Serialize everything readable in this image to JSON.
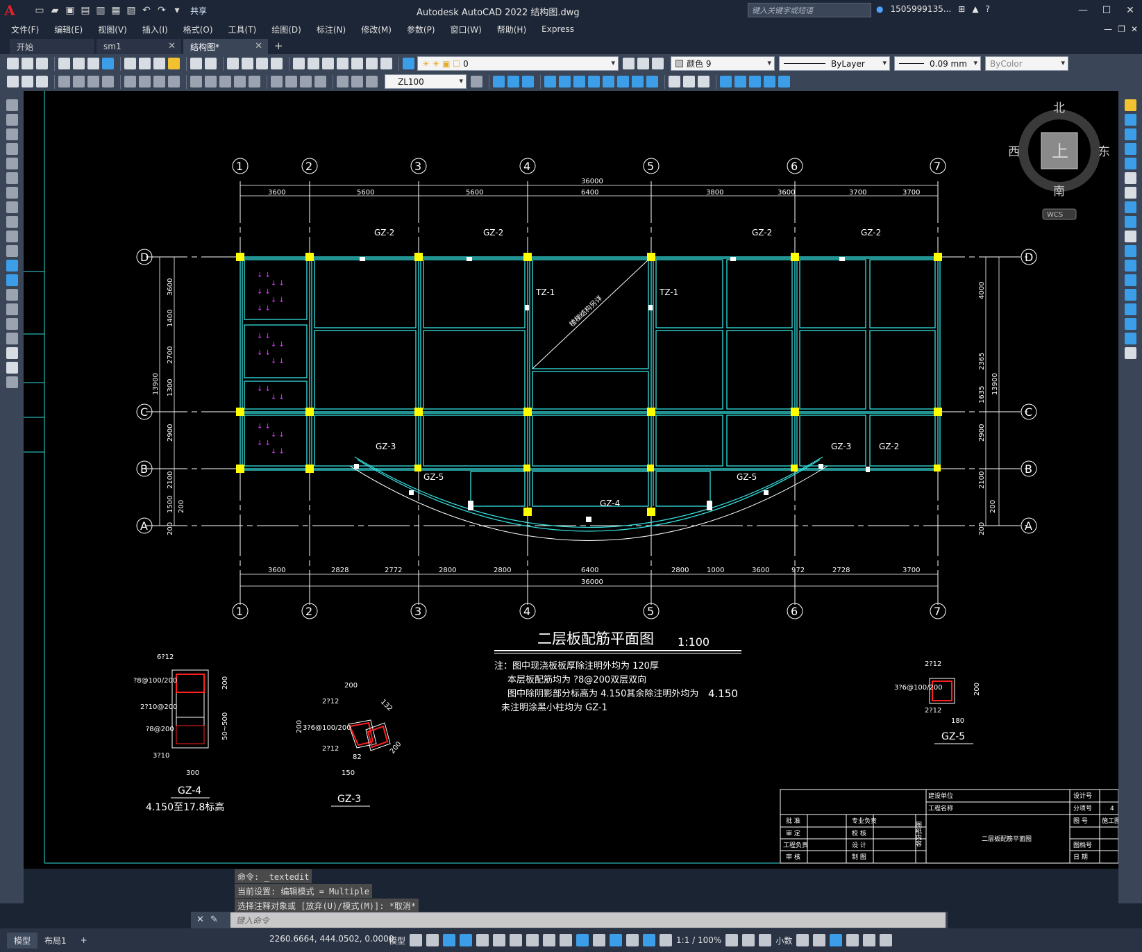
{
  "titlebar": {
    "app_title": "Autodesk AutoCAD 2022    结构图.dwg",
    "share_label": "共享",
    "search_placeholder": "键入关键字或短语",
    "user": "1505999135..."
  },
  "menu": [
    "文件(F)",
    "编辑(E)",
    "视图(V)",
    "插入(I)",
    "格式(O)",
    "工具(T)",
    "绘图(D)",
    "标注(N)",
    "修改(M)",
    "参数(P)",
    "窗口(W)",
    "帮助(H)",
    "Express"
  ],
  "tabs": [
    {
      "label": "开始"
    },
    {
      "label": "sm1"
    },
    {
      "label": "结构图*"
    }
  ],
  "toolbar": {
    "layer_value": "0",
    "color_value": "颜色 9",
    "linetype_value": "ByLayer",
    "lineweight_value": "0.09 mm",
    "plotstyle_value": "ByColor",
    "textstyle_value": "ZL100"
  },
  "viewcube": {
    "north": "北",
    "south": "南",
    "east": "东",
    "west": "西",
    "top": "上",
    "wcs": "WCS"
  },
  "drawing": {
    "grid_numbers": [
      "1",
      "2",
      "3",
      "4",
      "5",
      "6",
      "7"
    ],
    "grid_letters": [
      "D",
      "C",
      "B",
      "A"
    ],
    "top_total": "36000",
    "top_spans": [
      "3600",
      "5600",
      "5600",
      "6400",
      "3800",
      "3600",
      "3700",
      "3700"
    ],
    "bottom_spans": [
      "3600",
      "2828",
      "2772",
      "2800",
      "2800",
      "6400",
      "2800",
      "1000",
      "3600",
      "972",
      "2728",
      "3700"
    ],
    "bottom_total": "36000",
    "left_dims": [
      "3600",
      "1400",
      "2700",
      "1300",
      "2900",
      "2100",
      "1500",
      "200",
      "200"
    ],
    "left_total": "13900",
    "right_dims": [
      "4000",
      "2365",
      "1635",
      "2900",
      "2100",
      "200",
      "200"
    ],
    "right_total": "13900",
    "gz_labels": [
      "GZ-2",
      "GZ-2",
      "GZ-2",
      "GZ-2",
      "GZ-3",
      "GZ-5",
      "GZ-4",
      "GZ-5",
      "GZ-3",
      "GZ-2"
    ],
    "tz_labels": [
      "TZ-1",
      "TZ-1"
    ],
    "stair_note": "楼梯结构另详",
    "plan_title": "二层板配筋平面图",
    "plan_scale": "1:100",
    "notes": [
      "注：图中现浇板板厚除注明外均为 120厚",
      "本层板配筋均为 ?8@200双层双向",
      "图中除阴影部分标高为 4.150其余除注明外均为",
      "未注明涂黑小柱均为 GZ-1"
    ],
    "note_elev": "4.150",
    "gz4": {
      "name": "GZ-4",
      "r1": "6?12",
      "r2": "?8@100/200",
      "r3": "2?10@200",
      "r4": "?8@200",
      "r5": "3?10",
      "w": "300",
      "h": "200",
      "h2": "50~500",
      "elev": "4.150至17.8标高"
    },
    "gz3": {
      "name": "GZ-3",
      "r1": "2?12",
      "r2": "3?6@100/200",
      "r3": "2?12",
      "d1": "200",
      "d2": "132",
      "d3": "200",
      "d4": "200",
      "d5": "150",
      "d6": "82"
    },
    "gz5": {
      "name": "GZ-5",
      "r1": "2?12",
      "r2": "3?6@100/200",
      "r3": "2?12",
      "w": "180",
      "h": "200"
    },
    "titleblock": {
      "build_unit": "建设单位",
      "project": "工程名称",
      "r1": [
        "批  准",
        "专业负责"
      ],
      "r2": [
        "审  定",
        "校  核"
      ],
      "r3": [
        "工程负责",
        "设  计"
      ],
      "r4": [
        "审  核",
        "制  图"
      ],
      "vert": "图纸内容",
      "content": "二层板配筋平面图",
      "right": [
        "设计号",
        "分项号",
        "图  号",
        "图档号",
        "日  期"
      ],
      "rvals": [
        "",
        "4",
        "施工图",
        "",
        ""
      ]
    }
  },
  "command": {
    "history": [
      "命令: _textedit",
      "当前设置: 编辑模式 = Multiple",
      "选择注释对象或 [放弃(U)/模式(M)]: *取消*"
    ],
    "placeholder": "键入命令"
  },
  "status": {
    "model_tab": "模型",
    "layout_tab": "布局1",
    "coords": "2260.6664, 444.0502, 0.0000",
    "space": "模型",
    "scale": "1:1 / 100%",
    "units": "小数"
  }
}
